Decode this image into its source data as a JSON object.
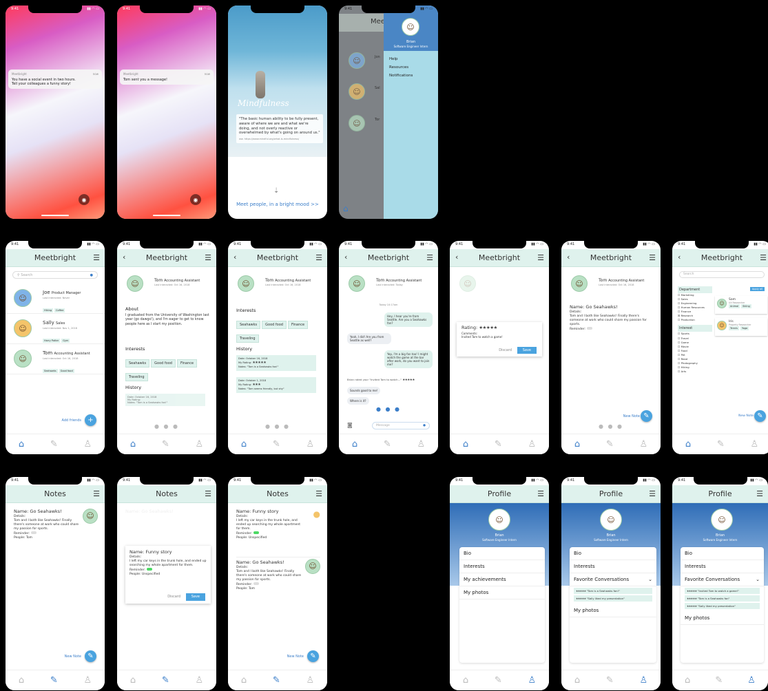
{
  "app": "Meetbright",
  "status_time": "9:41",
  "lock1": {
    "app": "Meetbright",
    "when": "now",
    "line1": "You have a social event in two hours.",
    "line2": "Tell your colleagues a funny story!"
  },
  "lock2": {
    "app": "Meetbright",
    "when": "now",
    "line1": "Tom sent you a message!"
  },
  "splash": {
    "title": "Mindfulness",
    "quote": "\"The basic human ability to be fully present, aware of where we are and what we're doing, and not overly reactive or overwhelmed by what's going on around us.\"",
    "source": "ww. https://www.mindful.org/what-is-mindfulness/",
    "cta": "Meet people, in a bright mood >>"
  },
  "drawer": {
    "title": "Mee",
    "user": "Brian",
    "role": "Software Engineer Intern",
    "items": [
      "Help",
      "Resources",
      "Notifications"
    ],
    "bg_initials": [
      "Jon",
      "Sal",
      "Tor"
    ]
  },
  "search": {
    "placeholder": "Search"
  },
  "people": [
    {
      "name": "Joe",
      "role": "Product Manager",
      "meta": "Last interacted: Never",
      "tags": [
        "Hiking",
        "Coffee"
      ]
    },
    {
      "name": "Sally",
      "role": "Sales",
      "meta": "Last interacted: Nov 1, 2018",
      "tags": [
        "Harry Potter",
        "Gym"
      ]
    },
    {
      "name": "Tom",
      "role": "Accounting Assistant",
      "meta": "Last interacted: Oct 16, 2018",
      "tags": [
        "Seahawks",
        "Good food"
      ]
    }
  ],
  "add_friends": "Add friends",
  "tom": {
    "name": "Tom",
    "role": "Accounting Assistant",
    "meta": "Last interacted: Oct 16, 2018",
    "meta_today": "Last interacted: Today"
  },
  "about": {
    "heading": "About",
    "text": "I graduated from the University of Washington last year (go dawgs!), and I'm eager to get to know people here as I start my position."
  },
  "interests": {
    "heading": "Interests",
    "chips": [
      "Seahawks",
      "Good food",
      "Finance",
      "Traveling"
    ]
  },
  "history": {
    "heading": "History",
    "entries": [
      {
        "date": "Date: October 16, 2018",
        "rating_label": "My Rating:",
        "stars": "★★★★★",
        "notes": "Notes: \"Tom is a Seahawks fan!\""
      },
      {
        "date": "Date: October 1, 2018",
        "rating_label": "My Rating:",
        "stars": "★★★",
        "notes": "Notes: \"Tom seems friendly, but shy\""
      }
    ]
  },
  "chat": {
    "day": "Today 10:17am",
    "msgs": [
      "Hey, I hear you're from Seattle. Are you a Seahawks fan?",
      "Yeah, I did! Are you from Seattle as well?",
      "Yep, I'm a big fan too! I might watch the game at the bar after work, do you want to join me?",
      "Sounds good to me!",
      "Where is it?"
    ],
    "system": "Brian rated your \"Invited Tom to watch...\"",
    "input": "Message"
  },
  "rating": {
    "label": "Rating:",
    "stars": "★★★★★",
    "comments_label": "Comments:",
    "comment": "Invited Tom to watch a game!",
    "discard": "Discard",
    "save": "Save"
  },
  "note_detail": {
    "name": "Name: Go Seahawks!",
    "details_label": "Details:",
    "details": "Tom and I both like Seahawks! Finally there's someone at work who could share my passion for sports.",
    "reminder": "Reminder:",
    "new_note": "New Note"
  },
  "filter": {
    "dept_heading": "Department",
    "depts": [
      "Marketing",
      "Sales",
      "Engineering",
      "Human Resources",
      "Finance",
      "Research",
      "Production"
    ],
    "int_heading": "Interest",
    "ints": [
      "Sports",
      "Travel",
      "Game",
      "Movie",
      "Food",
      "Pet",
      "Read",
      "Photography",
      "Hiking",
      "Arts"
    ],
    "apply": "Apply all",
    "results": [
      {
        "name": "Sam",
        "role": "UX Researcher",
        "tags": [
          "Animal",
          "Skiing"
        ]
      },
      {
        "name": "Iris",
        "role": "Property Researcher",
        "tags": [
          "Tennis",
          "Yoga"
        ]
      }
    ],
    "new_note": "New Note"
  },
  "notes": {
    "title": "Notes",
    "new_note": "New Note",
    "a": {
      "name": "Name: Go Seahawks!",
      "details_label": "Details:",
      "details": "Tom and I both like Seahawks! Finally there's someone at work who could share my passion for sports.",
      "reminder": "Reminder:",
      "people": "People: Tom"
    },
    "b": {
      "name": "Name: Funny story",
      "details_label": "Details:",
      "details": "I left my car keys in the trunk hole, and ended up searching my whole apartment for them.",
      "reminder": "Reminder:",
      "people": "People: Unspecified"
    },
    "discard": "Discard",
    "save": "Save"
  },
  "profile": {
    "title": "Profile",
    "user": "Brian",
    "role": "Software Engineer Intern",
    "items": [
      "Bio",
      "Interests",
      "My achievements",
      "My photos"
    ],
    "fav_heading": "Favorite Conversations",
    "favs": [
      {
        "stars": "★★★★★",
        "text": "\"Tom is a Seahawks fan!\""
      },
      {
        "stars": "★★★★★",
        "text": "\"Sally liked my presentation\""
      }
    ],
    "favs2": [
      {
        "stars": "★★★★★",
        "text": "\"Invited Tom to watch a game!\""
      },
      {
        "stars": "★★★★★",
        "text": "\"Tom is a Seahawks fan\""
      },
      {
        "stars": "★★★★★",
        "text": "\"Sally liked my presentation\""
      }
    ],
    "photos": "My photos"
  }
}
